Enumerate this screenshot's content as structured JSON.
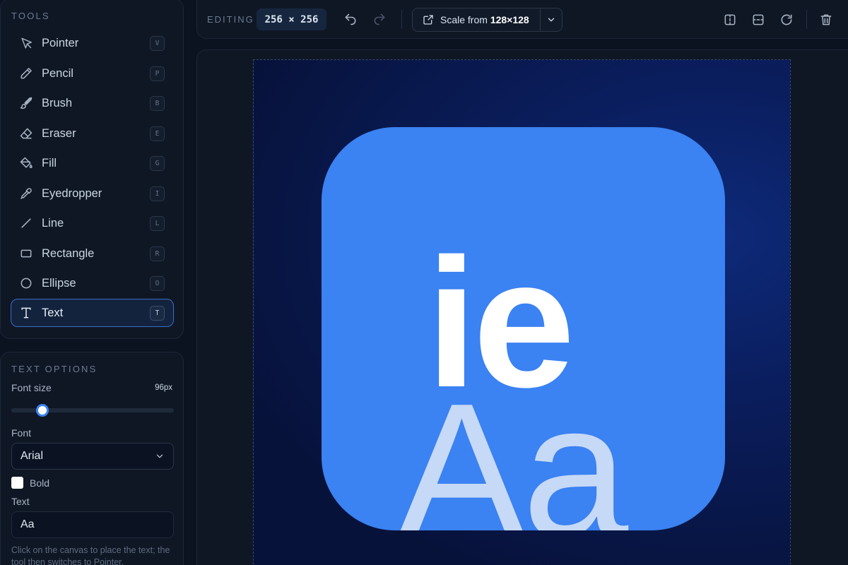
{
  "tools": {
    "title": "TOOLS",
    "items": [
      {
        "label": "Pointer",
        "shortcut": "V",
        "icon": "pointer-icon"
      },
      {
        "label": "Pencil",
        "shortcut": "P",
        "icon": "pencil-icon"
      },
      {
        "label": "Brush",
        "shortcut": "B",
        "icon": "brush-icon"
      },
      {
        "label": "Eraser",
        "shortcut": "E",
        "icon": "eraser-icon"
      },
      {
        "label": "Fill",
        "shortcut": "G",
        "icon": "fill-bucket-icon"
      },
      {
        "label": "Eyedropper",
        "shortcut": "I",
        "icon": "eyedropper-icon"
      },
      {
        "label": "Line",
        "shortcut": "L",
        "icon": "line-icon"
      },
      {
        "label": "Rectangle",
        "shortcut": "R",
        "icon": "rectangle-icon"
      },
      {
        "label": "Ellipse",
        "shortcut": "O",
        "icon": "ellipse-icon"
      },
      {
        "label": "Text",
        "shortcut": "T",
        "icon": "text-icon",
        "active": true
      }
    ]
  },
  "text_options": {
    "title": "TEXT OPTIONS",
    "font_size_label": "Font size",
    "font_size_value": "96px",
    "font_size_slider_fraction": 0.19,
    "font_label": "Font",
    "font_value": "Arial",
    "bold_label": "Bold",
    "bold_checked": false,
    "text_label": "Text",
    "text_value": "Aa",
    "hint": "Click on the canvas to place the text; the tool then switches to Pointer."
  },
  "toolbar": {
    "editing_label": "EDITING",
    "size": "256 × 256",
    "scale_prefix": "Scale from ",
    "scale_value": "128×128",
    "icons": [
      "undo-icon",
      "redo-icon",
      "scale-icon",
      "chevron-down-icon",
      "flip-horizontal-icon",
      "flip-vertical-icon",
      "rotate-icon",
      "trash-icon"
    ]
  },
  "canvas": {
    "top_glyphs": "ie",
    "bottom_glyphs": "Aa",
    "tile_color": "#3b82f2",
    "background_color": "#07123a"
  },
  "colors": {
    "accent": "#3b82f6",
    "active_border": "#3a6bc6"
  }
}
